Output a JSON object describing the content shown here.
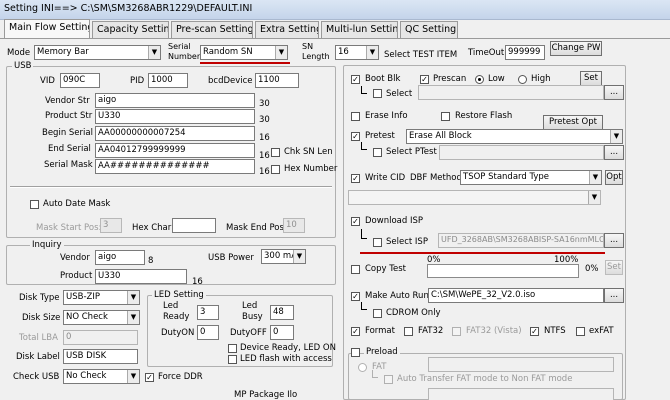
{
  "window": {
    "title": "Setting INI==> C:\\SM\\SM3268ABR1229\\DEFAULT.INI"
  },
  "tabs": [
    "Main Flow Setting",
    "Capacity Setting",
    "Pre-scan Setting",
    "Extra Setting",
    "Multi-lun Setting",
    "QC Setting"
  ],
  "top": {
    "mode_label": "Mode",
    "mode_value": "Memory Bar",
    "serial_number_label": "Serial Number",
    "serial_number_value": "Random SN",
    "sn_length_label": "SN Length",
    "sn_length_value": "16",
    "select_test_item": "Select TEST ITEM",
    "timeout_label": "TimeOut",
    "timeout_value": "999999",
    "change_pw": "Change PW"
  },
  "usb": {
    "title": "USB",
    "vid_label": "VID",
    "vid_value": "090C",
    "pid_label": "PID",
    "pid_value": "1000",
    "bcd_label": "bcdDevice",
    "bcd_value": "1100",
    "vendor_str_label": "Vendor Str",
    "vendor_str_value": "aigo",
    "vendor_str_len": "30",
    "product_str_label": "Product Str",
    "product_str_value": "U330",
    "product_str_len": "30",
    "begin_serial_label": "Begin Serial",
    "begin_serial_value": "AA00000000007254",
    "begin_serial_len": "16",
    "end_serial_label": "End Serial",
    "end_serial_value": "AA04012799999999",
    "end_serial_len": "16",
    "chk_sn_len": "Chk SN Len",
    "serial_mask_label": "Serial Mask",
    "serial_mask_value": "AA##############",
    "serial_mask_len": "16",
    "hex_number": "Hex Number",
    "auto_date_mask": "Auto Date Mask",
    "mask_start_label": "Mask Start Pos:",
    "mask_start_value": "3",
    "hex_char_label": "Hex Char:",
    "mask_end_label": "Mask End Pos:",
    "mask_end_value": "10"
  },
  "inquiry": {
    "title": "Inquiry",
    "vendor_label": "Vendor",
    "vendor_value": "aigo",
    "vendor_len": "8",
    "usb_power_label": "USB Power",
    "usb_power_value": "300 mA",
    "product_label": "Product",
    "product_value": "U330",
    "product_len": "16"
  },
  "disk": {
    "disk_type_label": "Disk Type",
    "disk_type_value": "USB-ZIP",
    "disk_size_label": "Disk Size",
    "disk_size_value": "NO Check",
    "total_lba_label": "Total LBA",
    "total_lba_value": "0",
    "disk_label_label": "Disk Label",
    "disk_label_value": "USB DISK",
    "check_usb_label": "Check USB",
    "check_usb_value": "No Check",
    "force_ddr": "Force DDR",
    "mp_package": "MP Package Ilo"
  },
  "led": {
    "title": "LED Setting",
    "led_ready_label": "Led Ready",
    "led_ready_value": "3",
    "led_busy_label": "Led Busy",
    "led_busy_value": "48",
    "dutyon_label": "DutyON",
    "dutyon_value": "0",
    "dutyoff_label": "DutyOFF",
    "dutyoff_value": "0",
    "device_ready": "Device Ready, LED ON",
    "led_flash": "LED flash with access"
  },
  "right": {
    "boot_blk": "Boot Blk",
    "prescan": "Prescan",
    "low": "Low",
    "high": "High",
    "set": "Set",
    "select": "Select",
    "browse": "...",
    "erase_info": "Erase Info",
    "restore_flash": "Restore Flash",
    "pretest_opt": "Pretest Opt",
    "pretest": "Pretest",
    "pretest_value": "Erase All Block",
    "select_ptest": "Select PTest",
    "write_cid": "Write CID",
    "dbf_method": "DBF Method",
    "dbf_value": "TSOP Standard Type",
    "opt": "Opt",
    "download_isp": "Download ISP",
    "select_isp": "Select ISP",
    "isp_path": "UFD_3268AB\\SM3268ABISP-SA16nmMLC.BIN",
    "copy_test": "Copy Test",
    "pct_0": "0%",
    "pct_100": "100%",
    "pct_0b": "0%",
    "set2": "Set",
    "make_auto_run": "Make Auto Run",
    "auto_run_path": "C:\\SM\\WePE_32_V2.0.iso",
    "cdrom_only": "CDROM Only",
    "format": "Format",
    "fat32": "FAT32",
    "fat32_vista": "FAT32 (Vista)",
    "ntfs": "NTFS",
    "exfat": "exFAT",
    "preload": "Preload",
    "fat": "FAT",
    "auto_transfer": "Auto Transfer FAT mode to Non FAT mode"
  },
  "colors": {
    "annotation": "#c00000",
    "titlebar": "#c4d4ea"
  }
}
